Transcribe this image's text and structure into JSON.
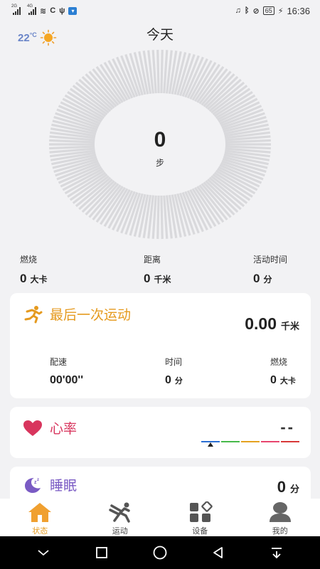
{
  "status_bar": {
    "network_1": "2G",
    "network_2": "4G",
    "battery": "65",
    "time": "16:36"
  },
  "header": {
    "temperature": "22",
    "temp_unit": "°C",
    "weather_icon": "sun-icon",
    "title": "今天"
  },
  "steps": {
    "value": "0",
    "unit": "步"
  },
  "stats": [
    {
      "label": "燃烧",
      "value": "0",
      "unit": "大卡"
    },
    {
      "label": "距离",
      "value": "0",
      "unit": "千米"
    },
    {
      "label": "活动时间",
      "value": "0",
      "unit": "分"
    }
  ],
  "last_workout": {
    "title": "最后一次运动",
    "icon": "running-icon",
    "distance": "0.00",
    "distance_unit": "千米",
    "pace_label": "配速",
    "pace_value": "00'00''",
    "time_label": "时间",
    "time_value": "0",
    "time_unit": "分",
    "burn_label": "燃烧",
    "burn_value": "0",
    "burn_unit": "大卡"
  },
  "heart_rate": {
    "title": "心率",
    "icon": "heart-icon",
    "value": "--"
  },
  "sleep": {
    "title": "睡眠",
    "icon": "moon-icon",
    "value": "0",
    "unit": "分"
  },
  "tabs": [
    {
      "label": "状态",
      "icon": "home-icon",
      "active": true
    },
    {
      "label": "运动",
      "icon": "sport-icon",
      "active": false
    },
    {
      "label": "设备",
      "icon": "device-icon",
      "active": false
    },
    {
      "label": "我的",
      "icon": "profile-icon",
      "active": false
    }
  ],
  "colors": {
    "accent": "#e59a1f",
    "heart": "#d8355d",
    "sleep": "#7a5bc4",
    "hr_zones": [
      "#2b6fd3",
      "#46b94a",
      "#e5a21f",
      "#e8456e",
      "#d83838"
    ]
  }
}
